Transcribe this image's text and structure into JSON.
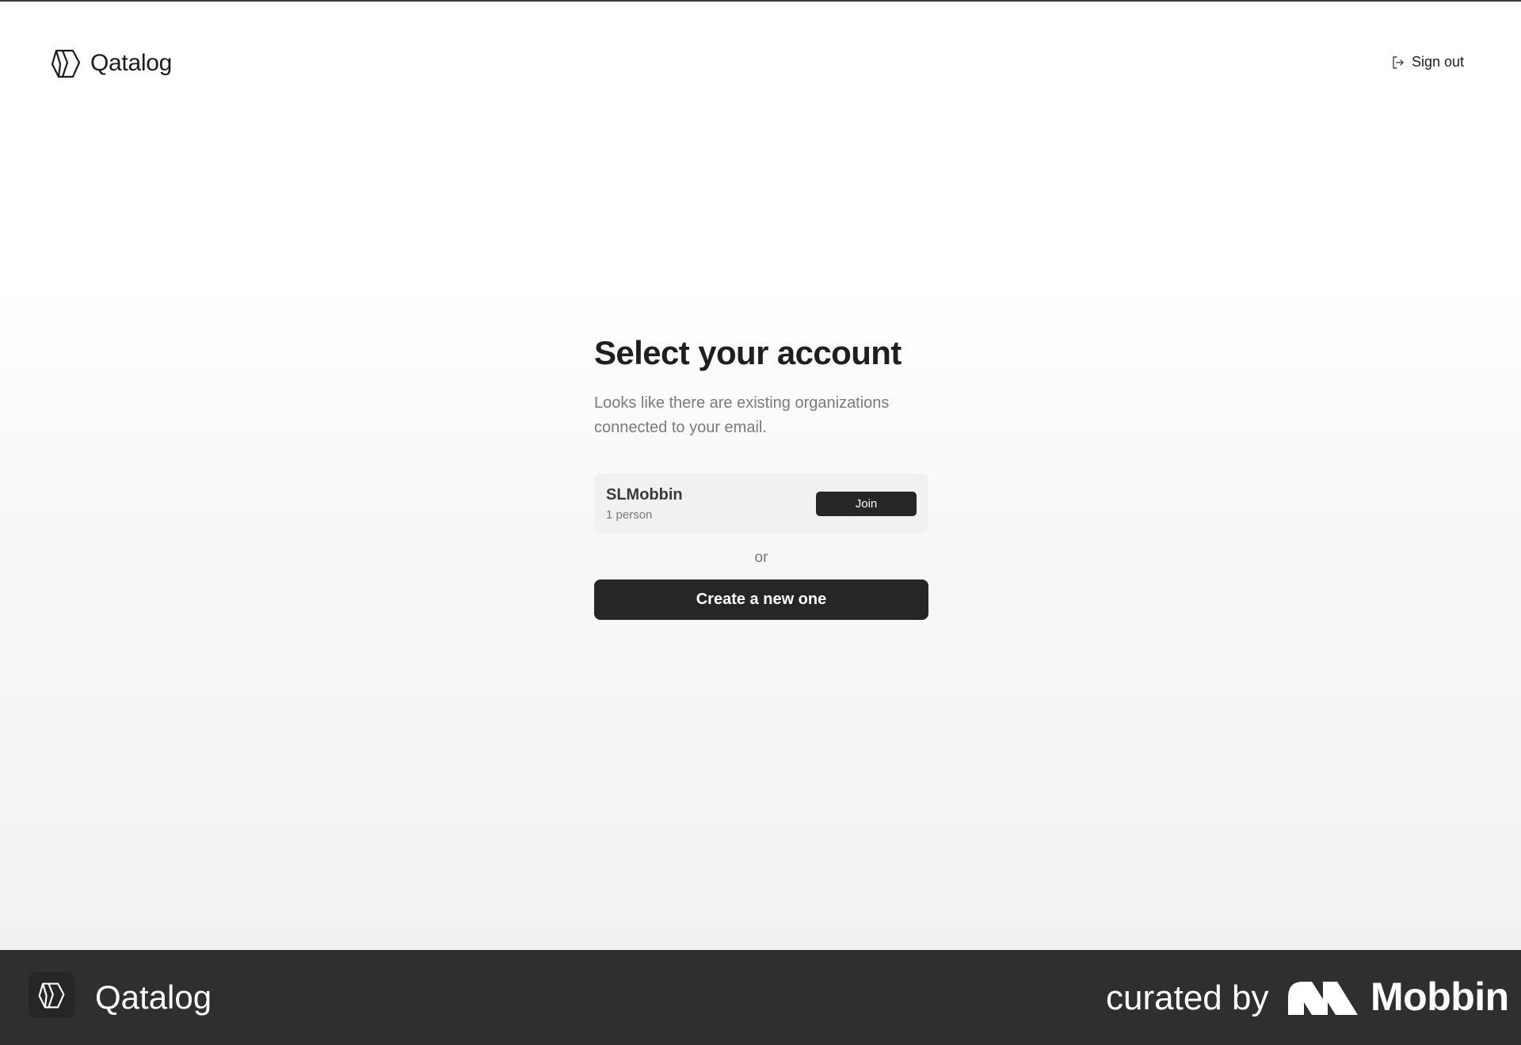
{
  "header": {
    "brand": "Qatalog",
    "sign_out_label": "Sign out"
  },
  "main": {
    "title": "Select your account",
    "subtitle": "Looks like there are existing organizations connected to your email.",
    "organizations": [
      {
        "name": "SLMobbin",
        "members": "1 person",
        "action_label": "Join"
      }
    ],
    "separator": "or",
    "create_label": "Create a new one"
  },
  "footer": {
    "brand": "Qatalog",
    "curated_by": "curated by",
    "curator": "Mobbin"
  },
  "colors": {
    "primary_button": "#262626",
    "card_background": "#f1f1f2",
    "footer_background": "#2f2f2f"
  },
  "icons": {
    "logo": "qatalog-logo-icon",
    "sign_out": "sign-out-icon",
    "curator_logo": "mobbin-logo-icon"
  }
}
